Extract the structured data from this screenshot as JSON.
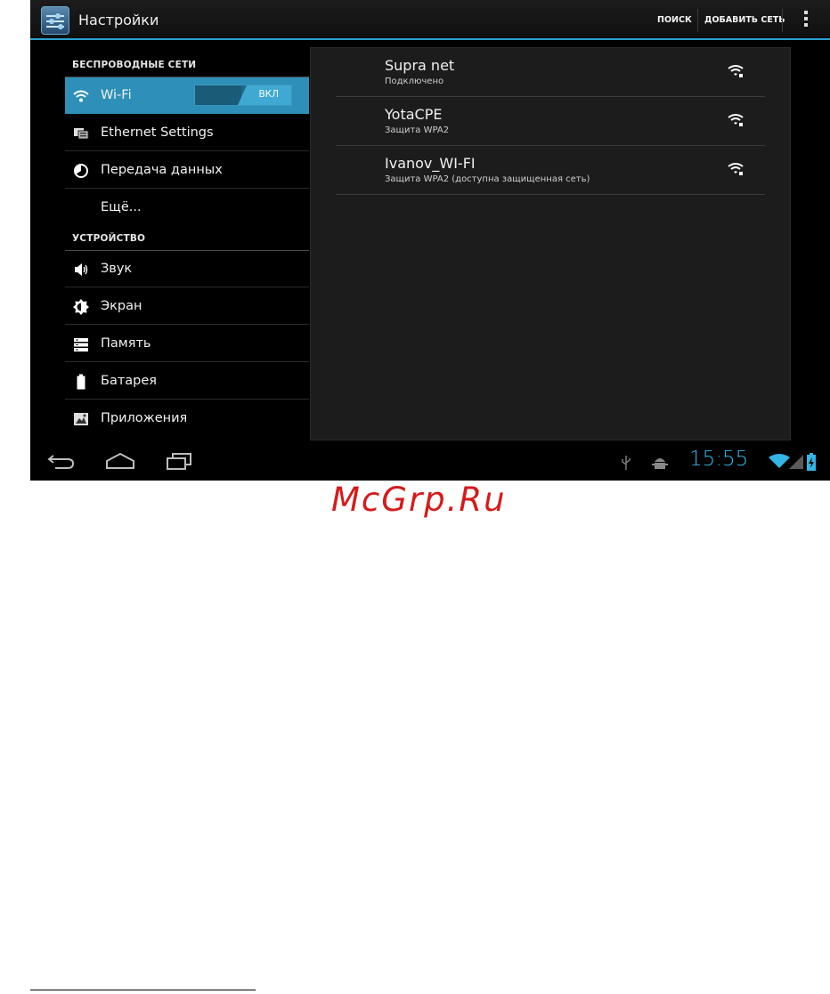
{
  "action_bar": {
    "title": "Настройки",
    "search_label": "ПОИСК",
    "add_network_label": "ДОБАВИТЬ СЕТЬ",
    "accent_color": "#2aa0cf"
  },
  "sidebar": {
    "sections": [
      {
        "header": "БЕСПРОВОДНЫЕ СЕТИ",
        "items": [
          {
            "label": "Wi-Fi",
            "icon": "wifi-icon",
            "selected": true,
            "toggle": "ВКЛ"
          },
          {
            "label": "Ethernet Settings",
            "icon": "ethernet-icon"
          },
          {
            "label": "Передача данных",
            "icon": "data-usage-icon"
          },
          {
            "label": "Ещё...",
            "icon": ""
          }
        ]
      },
      {
        "header": "УСТРОЙСТВО",
        "items": [
          {
            "label": "Звук",
            "icon": "speaker-icon"
          },
          {
            "label": "Экран",
            "icon": "brightness-icon"
          },
          {
            "label": "Память",
            "icon": "storage-icon"
          },
          {
            "label": "Батарея",
            "icon": "battery-icon"
          },
          {
            "label": "Приложения",
            "icon": "apps-icon"
          }
        ]
      }
    ]
  },
  "networks": [
    {
      "ssid": "Supra net",
      "status": "Подключено"
    },
    {
      "ssid": "YotaCPE",
      "status": "Защита WPA2"
    },
    {
      "ssid": "Ivanov_WI-FI",
      "status": "Защита WPA2 (доступна защищенная сеть)"
    }
  ],
  "status_bar": {
    "time": "15:55",
    "clock_color": "#33b5e5"
  },
  "watermark": "McGrp.Ru"
}
